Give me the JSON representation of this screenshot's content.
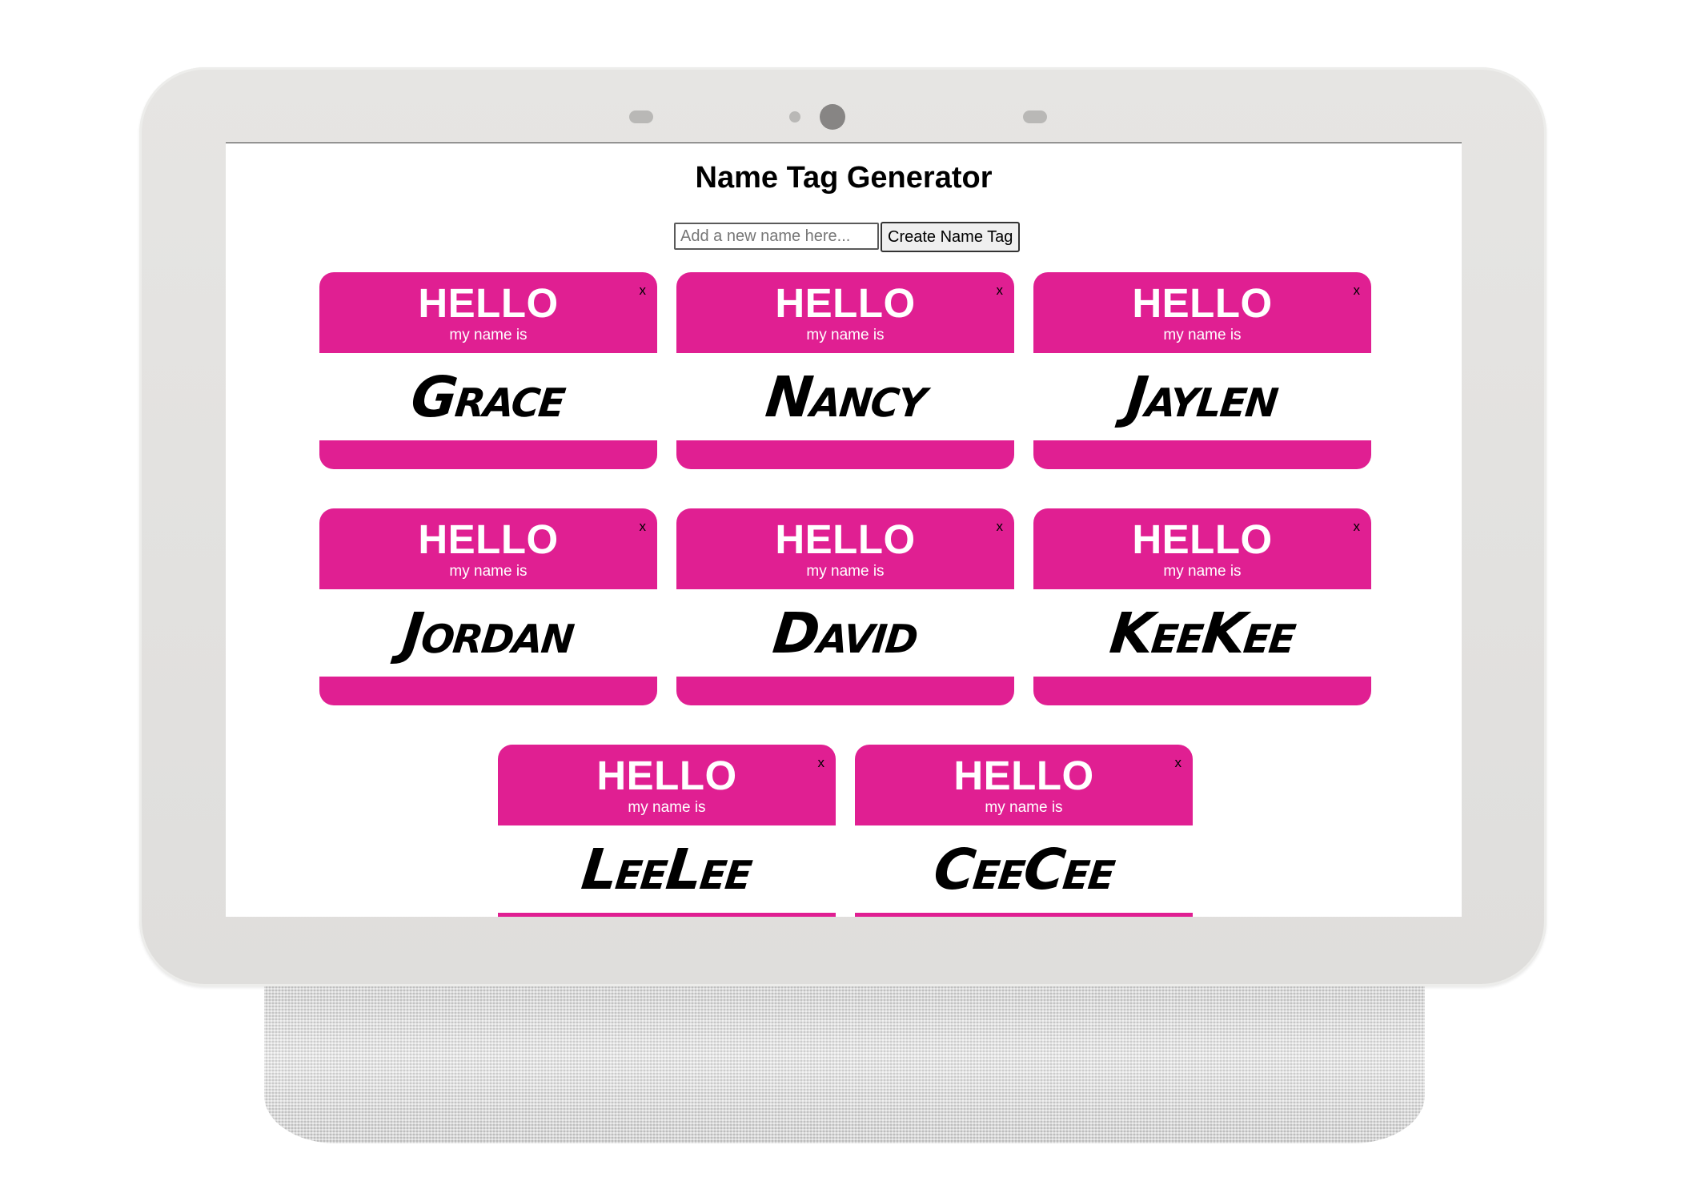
{
  "app": {
    "title": "Name Tag Generator"
  },
  "form": {
    "input_placeholder": "Add a new name here...",
    "input_value": "",
    "button_label": "Create Name Tag"
  },
  "tag_template": {
    "greeting": "HELLO",
    "subtitle": "my name is",
    "close_label": "x",
    "accent_color": "#e01f92"
  },
  "name_tags": [
    {
      "name": "Grace"
    },
    {
      "name": "Nancy"
    },
    {
      "name": "Jaylen"
    },
    {
      "name": "Jordan"
    },
    {
      "name": "David"
    },
    {
      "name": "KeeKee"
    },
    {
      "name": "LeeLee"
    },
    {
      "name": "CeeCee"
    }
  ]
}
